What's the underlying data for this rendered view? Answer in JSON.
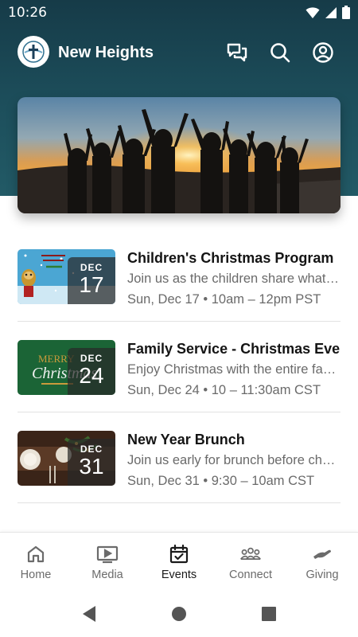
{
  "status_bar": {
    "time": "10:26"
  },
  "app_bar": {
    "title": "New Heights"
  },
  "events": [
    {
      "title": "Children's Christmas Program",
      "description": "Join us as the children share what Christmas means",
      "month": "DEC",
      "day": "17",
      "time": "Sun, Dec 17 • 10am – 12pm PST"
    },
    {
      "title": "Family Service - Christmas Eve",
      "description": "Enjoy Christmas with the entire family",
      "month": "DEC",
      "day": "24",
      "time": "Sun, Dec 24 • 10 – 11:30am CST"
    },
    {
      "title": "New Year Brunch",
      "description": "Join us early for brunch before church",
      "month": "DEC",
      "day": "31",
      "time": "Sun, Dec 31 • 9:30 – 10am CST"
    }
  ],
  "thumb_text": {
    "merry": "MERRY",
    "christmas": "Christmas"
  },
  "bottom_nav": [
    {
      "label": "Home",
      "icon": "home-icon"
    },
    {
      "label": "Media",
      "icon": "media-icon"
    },
    {
      "label": "Events",
      "icon": "calendar-icon",
      "active": true
    },
    {
      "label": "Connect",
      "icon": "people-icon"
    },
    {
      "label": "Giving",
      "icon": "hand-icon"
    }
  ],
  "colors": {
    "header": "#1d4f5c",
    "active_nav": "#1a1a1a",
    "inactive_nav": "#6b6b6b"
  }
}
